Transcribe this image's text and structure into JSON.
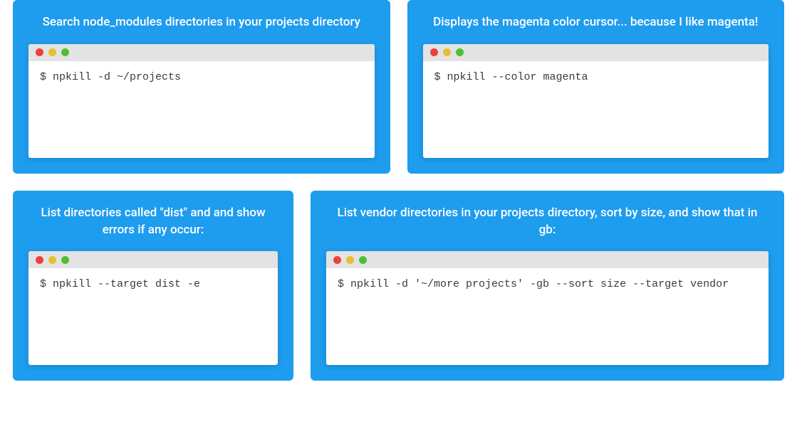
{
  "cards": [
    {
      "title": "Search node_modules directories in your projects directory",
      "command": "$ npkill -d ~/projects"
    },
    {
      "title": "Displays the magenta color cursor... because I like magenta!",
      "command": "$ npkill --color magenta"
    },
    {
      "title": "List directories called \"dist\" and and show errors if any occur:",
      "command": "$ npkill --target dist -e"
    },
    {
      "title": "List vendor directories in your projects directory, sort by size, and show that in gb:",
      "command": "$ npkill -d '~/more projects' -gb --sort size --target vendor"
    }
  ]
}
